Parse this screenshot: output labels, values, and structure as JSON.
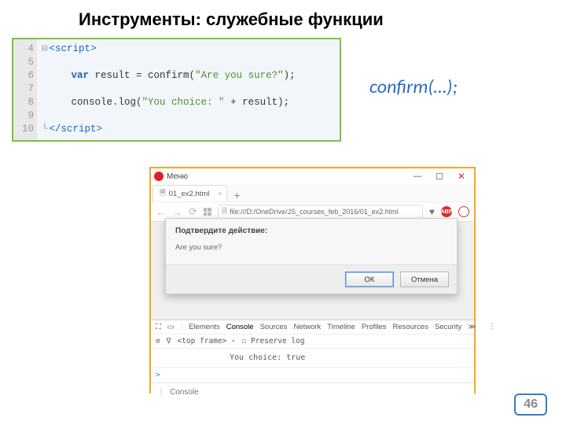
{
  "title": "Инструменты: служебные функции",
  "code": {
    "lines": [
      "4",
      "5",
      "6",
      "7",
      "8",
      "9",
      "10"
    ],
    "open_tag_lt": "<",
    "open_tag_name": "script",
    "open_tag_gt": ">",
    "var_kw": "var",
    "var_rest": " result = confirm(",
    "str1": "\"Are you sure?\"",
    "after1": ");",
    "log_call": "console.log(",
    "str2": "\"You choice: \"",
    "after2": " + result);",
    "close_tag_lt": "</",
    "close_tag_name": "script",
    "close_tag_gt": ">"
  },
  "confirm_label": "confirm(…);",
  "browser": {
    "menu": "Меню",
    "win_min": "—",
    "win_max": "☐",
    "win_close": "✕",
    "tab_label": "01_ex2.html",
    "tab_close": "×",
    "tab_plus": "+",
    "nav_back": "←",
    "nav_fwd": "→",
    "reload": "⟳",
    "file_icon": "🗎",
    "url": "file:///D:/OneDrive/JS_courses_feb_2016/01_ex2.html",
    "adblock": "ABP",
    "dialog_title": "Подтвердите действие:",
    "dialog_msg": "Are you sure?",
    "btn_ok": "ОК",
    "btn_cancel": "Отмена"
  },
  "devtools": {
    "inspect": "⛶",
    "device": "▭",
    "tabs": [
      "Elements",
      "Console",
      "Sources",
      "Network",
      "Timeline",
      "Profiles",
      "Resources",
      "Security"
    ],
    "more": "≫",
    "menu": "⋮",
    "clear": "⊘",
    "filter": "∇",
    "frame": "<top frame>",
    "frame_chev": "▾",
    "preserve": "☐ Preserve log",
    "output": "You choice: true",
    "prompt": ">",
    "footer_drawer": "⋮",
    "footer_tab": "Console"
  },
  "page_number": "46"
}
